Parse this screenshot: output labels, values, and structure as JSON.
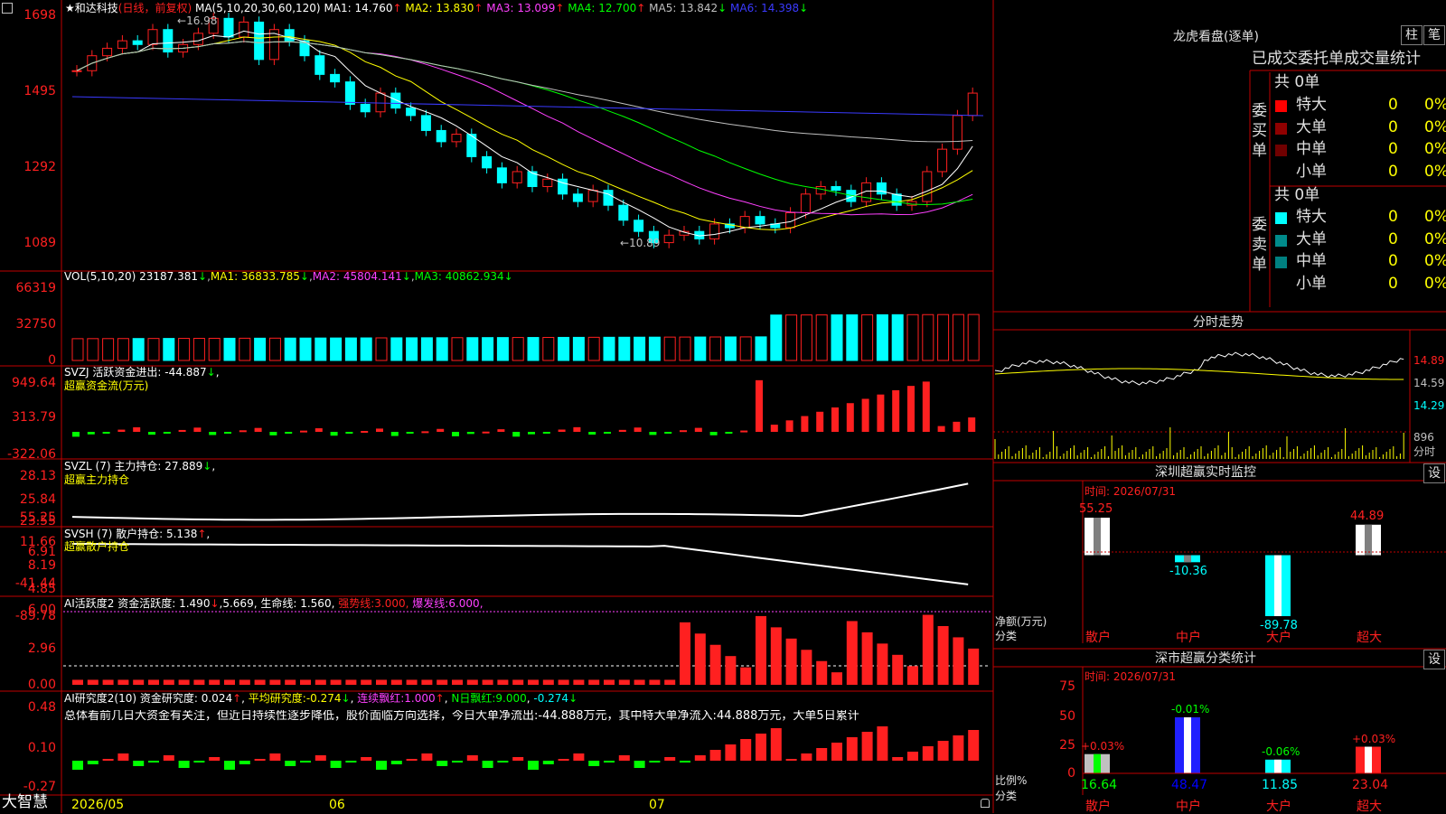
{
  "colors": {
    "up": "#ff2020",
    "down": "#00ffff",
    "green": "#00ff00",
    "yellow": "#ffff00",
    "magenta": "#ff40ff",
    "blue": "#3a3aff",
    "white": "#ffffff",
    "axis": "#c00000",
    "grey": "#c0c0c0"
  },
  "header": {
    "stock": "和达科技",
    "mode": "(日线，前复权)",
    "ma_label": "MA(5,10,20,30,60,120)",
    "ma": [
      {
        "l": "MA1:",
        "v": "14.760",
        "a": "↑",
        "c": "#ffffff"
      },
      {
        "l": "MA2:",
        "v": "13.830",
        "a": "↑",
        "c": "#ffff00"
      },
      {
        "l": "MA3:",
        "v": "13.099",
        "a": "↑",
        "c": "#ff40ff"
      },
      {
        "l": "MA4:",
        "v": "12.700",
        "a": "↑",
        "c": "#00ff00"
      },
      {
        "l": "MA5:",
        "v": "13.842",
        "a": "↓",
        "c": "#c0c0c0"
      },
      {
        "l": "MA6:",
        "v": "14.398",
        "a": "↓",
        "c": "#3a3aff"
      }
    ]
  },
  "price_panel": {
    "yticks": [
      "1698",
      "1495",
      "1292",
      "1089"
    ],
    "hi": "16.98",
    "lo": "10.89"
  },
  "vol_panel": {
    "label": "VOL(5,10,20)",
    "v": "23187.381",
    "ma1": "36833.785",
    "ma2": "45804.141",
    "ma3": "40862.934",
    "yticks": [
      "66319",
      "32750",
      "0"
    ]
  },
  "svzj_panel": {
    "label": "SVZJ",
    "t1": "活跃资金进出:",
    "v": "-44.887",
    "t2": "超赢资金流(万元)",
    "yticks": [
      "949.64",
      "313.79",
      "-322.06"
    ]
  },
  "svzl_panel": {
    "label": "SVZL (7)",
    "t1": "主力持仓:",
    "v": "27.889",
    "t2": "超赢主力持仓",
    "yticks": [
      "28.13",
      "25.84",
      "23.55"
    ]
  },
  "svsh_panel": {
    "label": "SVSH (7)",
    "t1": "散户持仓:",
    "v": "5.138",
    "t2": "超赢散户持仓",
    "yticks": [
      "11.66",
      "8.19",
      "4.85"
    ]
  },
  "ai1_panel": {
    "label": "AI活跃度2",
    "t1": "资金活跃度:",
    "v1": "1.490",
    "v2": "5.669",
    "t2": "生命线:",
    "v3": "1.560",
    "t3": "强势线:",
    "v4": "3.000",
    "t4": "爆发线:",
    "v5": "6.000",
    "yticks": [
      "6.00",
      "2.96",
      "0.00"
    ]
  },
  "ai2_panel": {
    "label": "AI研究度2(10)",
    "t1": "资金研究度:",
    "v1": "0.024",
    "t2": "平均研究度:",
    "v2": "-0.274",
    "t3": "连续飘红:",
    "v3": "1.000",
    "t4": "N日飘红:",
    "v4": "9.000",
    "v5": "-0.274",
    "comment": "总体看前几日大资金有关注，但近日持续性逐步降低，股价面临方向选择，今日大单净流出:-44.888万元，其中特大单净流入:44.888万元，大单5日累计",
    "yticks": [
      "0.48",
      "0.10",
      "-0.27"
    ]
  },
  "footer": {
    "brand": "大智慧",
    "dates": [
      "2026/05",
      "06",
      "07"
    ]
  },
  "lhb": {
    "title": "龙虎看盘(逐单)",
    "btn1": "柱",
    "btn2": "笔",
    "heading": "已成交委托单成交量统计",
    "buy_total": "共 0单",
    "buy_side": "委买单",
    "sell_total": "共 0单",
    "sell_side": "委卖单",
    "buy": [
      {
        "n": "特大",
        "q": "0",
        "p": "0%",
        "c": "#ff0000"
      },
      {
        "n": "大单",
        "q": "0",
        "p": "0%",
        "c": "#900000"
      },
      {
        "n": "中单",
        "q": "0",
        "p": "0%",
        "c": "#700000"
      },
      {
        "n": "小单",
        "q": "0",
        "p": "0%",
        "c": "#000000"
      }
    ],
    "sell": [
      {
        "n": "特大",
        "q": "0",
        "p": "0%",
        "c": "#00ffff"
      },
      {
        "n": "大单",
        "q": "0",
        "p": "0%",
        "c": "#008a8a"
      },
      {
        "n": "中单",
        "q": "0",
        "p": "0%",
        "c": "#008080"
      },
      {
        "n": "小单",
        "q": "0",
        "p": "0%",
        "c": "#000000"
      }
    ]
  },
  "intraday": {
    "title": "分时走势",
    "y": [
      "14.89",
      "14.59",
      "14.29"
    ],
    "vol": "896",
    "lbl": "分时"
  },
  "sz_monitor": {
    "title": "深圳超赢实时监控",
    "btn": "设",
    "time": "时间: 2026/07/31",
    "yticks": [
      "55.25",
      "6.91",
      "-41.44",
      "-89.78"
    ],
    "ylabel1": "净额(万元)",
    "ylabel2": "分类",
    "bars": [
      {
        "c": "散户",
        "v": "55.25"
      },
      {
        "c": "中户",
        "v": "-10.36"
      },
      {
        "c": "大户",
        "v": "-89.78"
      },
      {
        "c": "超大",
        "v": "44.89"
      }
    ]
  },
  "sc_stats": {
    "title": "深市超赢分类统计",
    "btn": "设",
    "time": "时间: 2026/07/31",
    "yticks": [
      "75",
      "50",
      "25",
      "0"
    ],
    "ylabel1": "比例%",
    "ylabel2": "分类",
    "bars": [
      {
        "c": "散户",
        "v": "16.64",
        "chg": "+0.03%"
      },
      {
        "c": "中户",
        "v": "48.47",
        "chg": "-0.01%"
      },
      {
        "c": "大户",
        "v": "11.85",
        "chg": "-0.06%"
      },
      {
        "c": "超大",
        "v": "23.04",
        "chg": "+0.03%"
      }
    ]
  }
}
